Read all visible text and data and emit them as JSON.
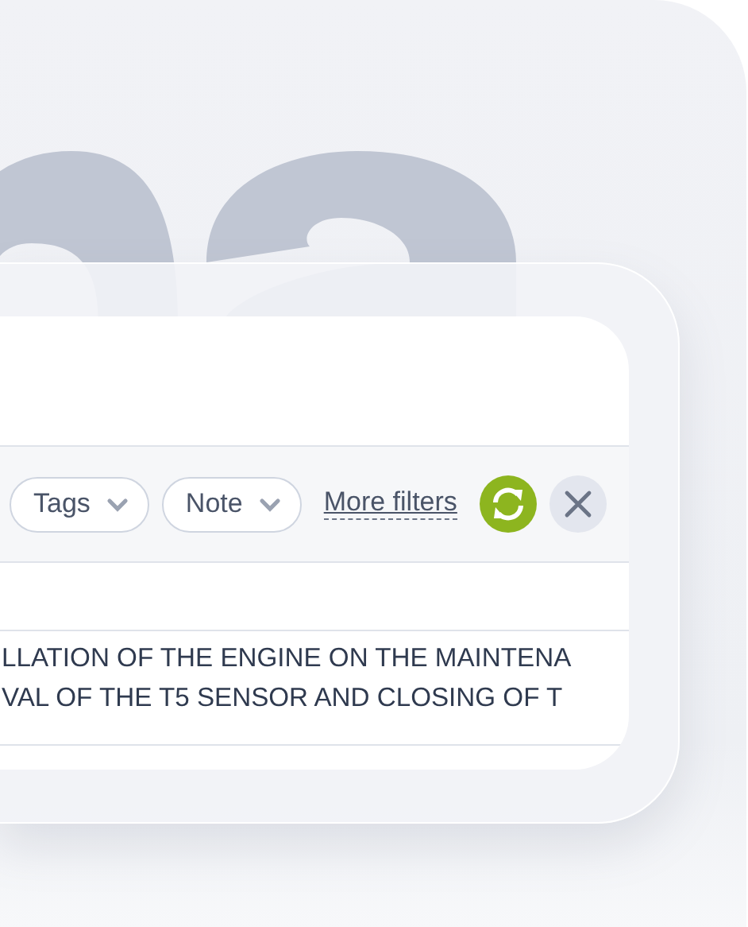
{
  "toolbar": {
    "filters": [
      {
        "label": "Tags"
      },
      {
        "label": "Note"
      }
    ],
    "more_filters": "More filters"
  },
  "description_lines": [
    "LLATION OF THE ENGINE ON THE MAINTENA",
    "VAL OF THE T5 SENSOR AND CLOSING OF T"
  ]
}
